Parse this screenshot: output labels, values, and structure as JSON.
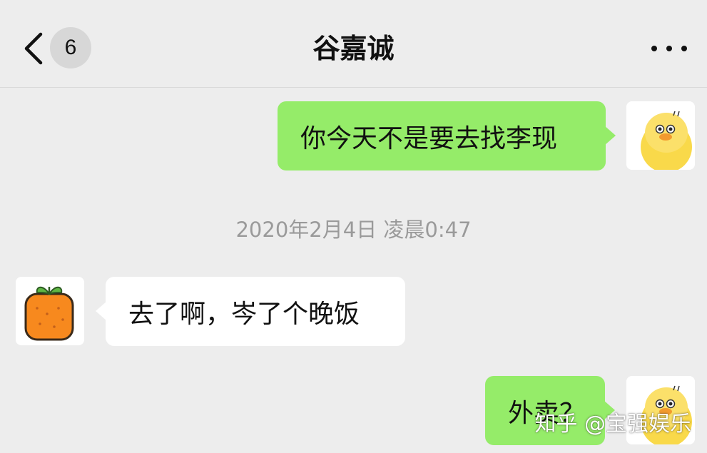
{
  "header": {
    "unread_count": "6",
    "title": "谷嘉诚"
  },
  "messages": [
    {
      "sender": "me",
      "text": "你今天不是要去找李现"
    },
    {
      "sender": "them",
      "text": "去了啊，岑了个晚饭"
    },
    {
      "sender": "me",
      "text": "外卖？"
    }
  ],
  "timestamp": "2020年2月4日 凌晨0:47",
  "watermark": "知乎 @宝强娱乐",
  "colors": {
    "background": "#ededed",
    "my_bubble": "#95ec69",
    "their_bubble": "#ffffff",
    "timestamp_text": "#9a9a9a"
  },
  "icons": {
    "back": "chevron-left-icon",
    "more": "ellipsis-icon",
    "my_avatar": "yellow-duck-avatar",
    "their_avatar": "orange-fruit-avatar"
  }
}
